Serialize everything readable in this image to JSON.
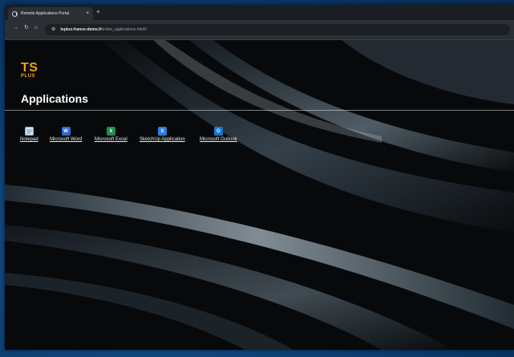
{
  "browser": {
    "tab_title": "Remote Applications Portal",
    "tab_close_glyph": "×",
    "new_tab_glyph": "+",
    "url_host": "tsplus-france-demo.fr",
    "url_path": "/index_applications.html#"
  },
  "logo": {
    "ts": "TS",
    "plus": "PLUS",
    "color": "#f0a21a"
  },
  "page": {
    "title": "Applications"
  },
  "apps": [
    {
      "label": "Notepad",
      "icon": "notepad-icon",
      "color": "#7fb2d9"
    },
    {
      "label": "Microsoft Word",
      "icon": "word-icon",
      "glyph": "W",
      "color": "#2b6bd1"
    },
    {
      "label": "Microsoft Excel",
      "icon": "excel-icon",
      "glyph": "X",
      "color": "#1f8a4c"
    },
    {
      "label": "SketchUp Application",
      "icon": "sketchup-icon",
      "glyph": "S",
      "color": "#2a7de1"
    },
    {
      "label": "Microsoft Outlook",
      "icon": "outlook-icon",
      "glyph": "O",
      "color": "#1976d2"
    }
  ]
}
